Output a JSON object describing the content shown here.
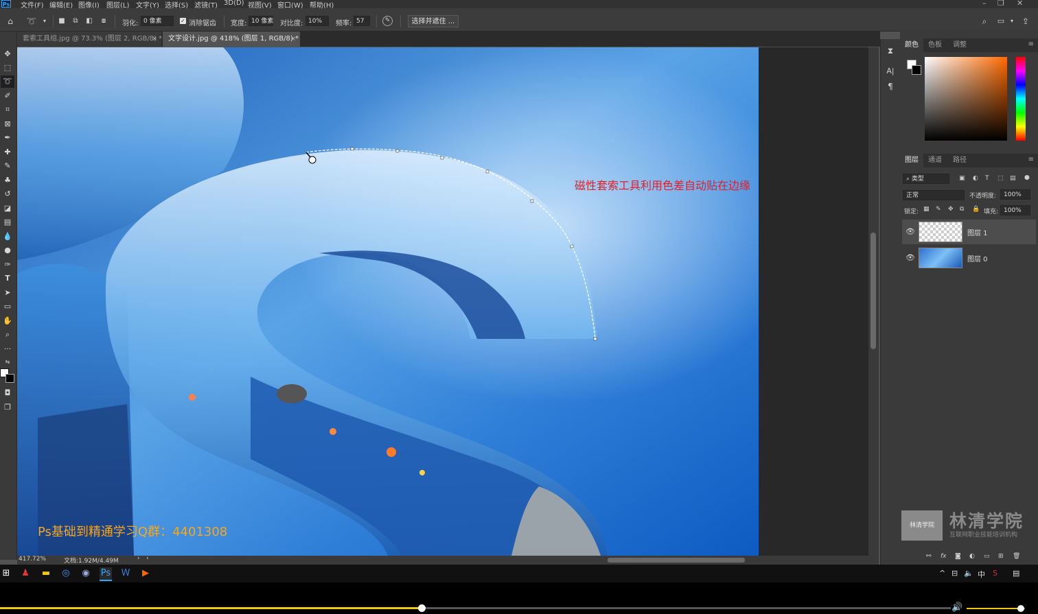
{
  "app": {
    "logo": "Ps"
  },
  "menu": [
    "文件(F)",
    "编辑(E)",
    "图像(I)",
    "图层(L)",
    "文字(Y)",
    "选择(S)",
    "滤镜(T)",
    "3D(D)",
    "视图(V)",
    "窗口(W)",
    "帮助(H)"
  ],
  "window_controls": {
    "minimize": "–",
    "restore": "❐",
    "close": "✕"
  },
  "options": {
    "feather_label": "羽化:",
    "feather_value": "0 像素",
    "antialias_label": "消除锯齿",
    "width_label": "宽度:",
    "width_value": "10 像素",
    "contrast_label": "对比度:",
    "contrast_value": "10%",
    "frequency_label": "频率:",
    "frequency_value": "57",
    "select_mask_button": "选择并遮住 ..."
  },
  "tabs": [
    {
      "label": "套索工具组.jpg @ 73.3% (图层 2, RGB/8) *",
      "close": "×",
      "active": false
    },
    {
      "label": "文字设计.jpg @ 418% (图层 1, RGB/8) *",
      "close": "×",
      "active": true
    }
  ],
  "canvas": {
    "annotation": "磁性套索工具利用色差自动贴在边缘",
    "qq_group": "Ps基础到精通学习Q群：4401308"
  },
  "status": {
    "zoom": "417.72%",
    "doc": "文档:1.92M/4.49M"
  },
  "color_panel": {
    "tabs": [
      "颜色",
      "色板",
      "调整"
    ],
    "foreground": "#ffffff",
    "background": "#000000",
    "accent": "#ff6a00"
  },
  "layers_panel": {
    "tabs": [
      "图层",
      "通道",
      "路径"
    ],
    "filter_label": "类型",
    "blend_mode": "正常",
    "opacity_label": "不透明度:",
    "opacity_value": "100%",
    "lock_label": "锁定:",
    "fill_label": "填充:",
    "fill_value": "100%",
    "layers": [
      {
        "name": "图层 1",
        "visible": true,
        "selected": true
      },
      {
        "name": "图层 0",
        "visible": true,
        "selected": false
      }
    ],
    "footer_icons": [
      "link-icon",
      "fx-icon",
      "mask-icon",
      "adjustment-icon",
      "folder-icon",
      "new-layer-icon",
      "trash-icon"
    ]
  },
  "watermark": {
    "box": "林清学院",
    "title": "林清学院",
    "subtitle": "互联网职业技能培训机构"
  },
  "taskbar": {
    "ime": "中"
  },
  "player": {
    "progress": 0.443,
    "volume": 0.93
  }
}
